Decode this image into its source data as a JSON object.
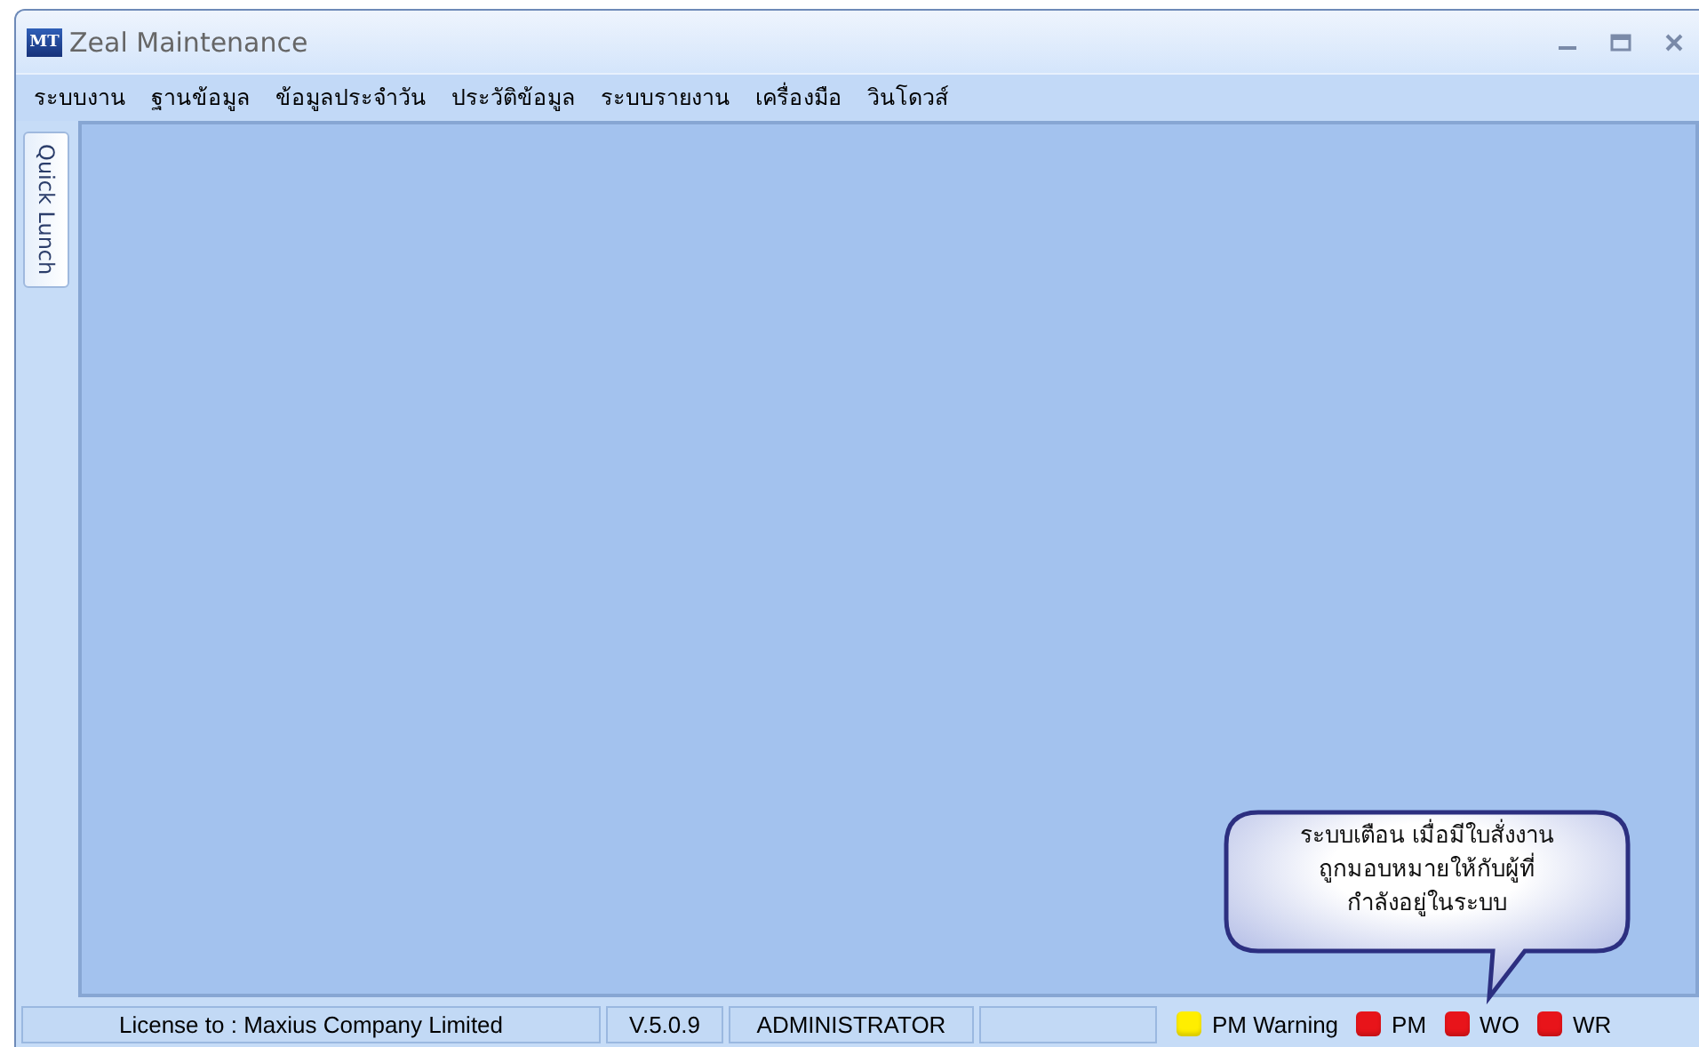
{
  "window": {
    "title": "Zeal Maintenance",
    "logo": "MT"
  },
  "menu": [
    "ระบบงาน",
    "ฐานข้อมูล",
    "ข้อมูลประจำวัน",
    "ประวัติข้อมูล",
    "ระบบรายงาน",
    "เครื่องมือ",
    "วินโดวส์"
  ],
  "side_tab": {
    "label": "Quick Lunch"
  },
  "callout": {
    "text": "ระบบเตือน เมื่อมีใบสั่งงาน\nถูกมอบหมายให้กับผู้ที่\nกำลังอยู่ในระบบ"
  },
  "status_bar": {
    "panels": [
      "License to : Maxius Company Limited",
      "V.5.0.9",
      "ADMINISTRATOR"
    ],
    "indicators": [
      {
        "label": "PM Warning",
        "color": "#ffee00"
      },
      {
        "label": "PM",
        "color": "#e8141a"
      },
      {
        "label": "WO",
        "color": "#e8141a"
      },
      {
        "label": "WR",
        "color": "#e8141a"
      }
    ]
  }
}
